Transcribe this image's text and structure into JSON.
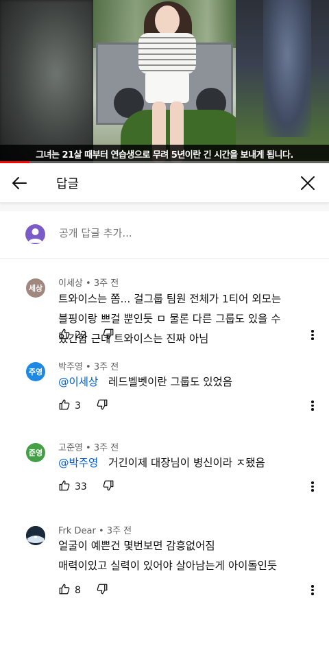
{
  "video": {
    "caption": "그녀는 21살 때부터 연습생으로 무려 5년이란 긴 시간을 보내게 됩니다.",
    "progress": 0.09,
    "accent_color": "#ff0000"
  },
  "header": {
    "title": "답글",
    "back_icon": "arrow-left-icon",
    "close_icon": "close-icon"
  },
  "add_reply": {
    "placeholder": "공개 답글 추가...",
    "avatar_color": "#7b5cc6"
  },
  "comments": [
    {
      "author": "이세상",
      "time": "3주 전",
      "avatar_text": "세상",
      "avatar_color": "#a1887f",
      "mention": "",
      "lines": [
        "트와이스는 쫌... 걸그룹 팀원 전체가 1티어 외모는",
        "블핑이랑 쁘걸 뿐인듯 ㅁ 물론 다른 그룹도 있을 수",
        "있긴함 근데 트와이스는 진짜 아님"
      ],
      "likes": "22"
    },
    {
      "author": "박주영",
      "time": "3주 전",
      "avatar_text": "주영",
      "avatar_color": "#1e88e5",
      "mention": "@이세상",
      "lines": [
        "레드벨벳이란 그룹도 있었음"
      ],
      "likes": "3"
    },
    {
      "author": "고준영",
      "time": "3주 전",
      "avatar_text": "준영",
      "avatar_color": "#43a047",
      "mention": "@박주영",
      "lines": [
        "거긴이제 대장님이 병신이라 ㅈ됐음"
      ],
      "likes": "33"
    },
    {
      "author": "Frk Dear",
      "time": "3주 전",
      "avatar_text": "",
      "avatar_color": "#1a2a3a",
      "mention": "",
      "lines": [
        "얼굴이 예쁜건 몇번보면 감흥없어짐",
        "매력이있고 실력이 있어야 살아남는게 아이돌인듯"
      ],
      "likes": "8"
    }
  ],
  "icons": {
    "like": "thumbs-up-icon",
    "dislike": "thumbs-down-icon",
    "more": "more-vertical-icon"
  }
}
